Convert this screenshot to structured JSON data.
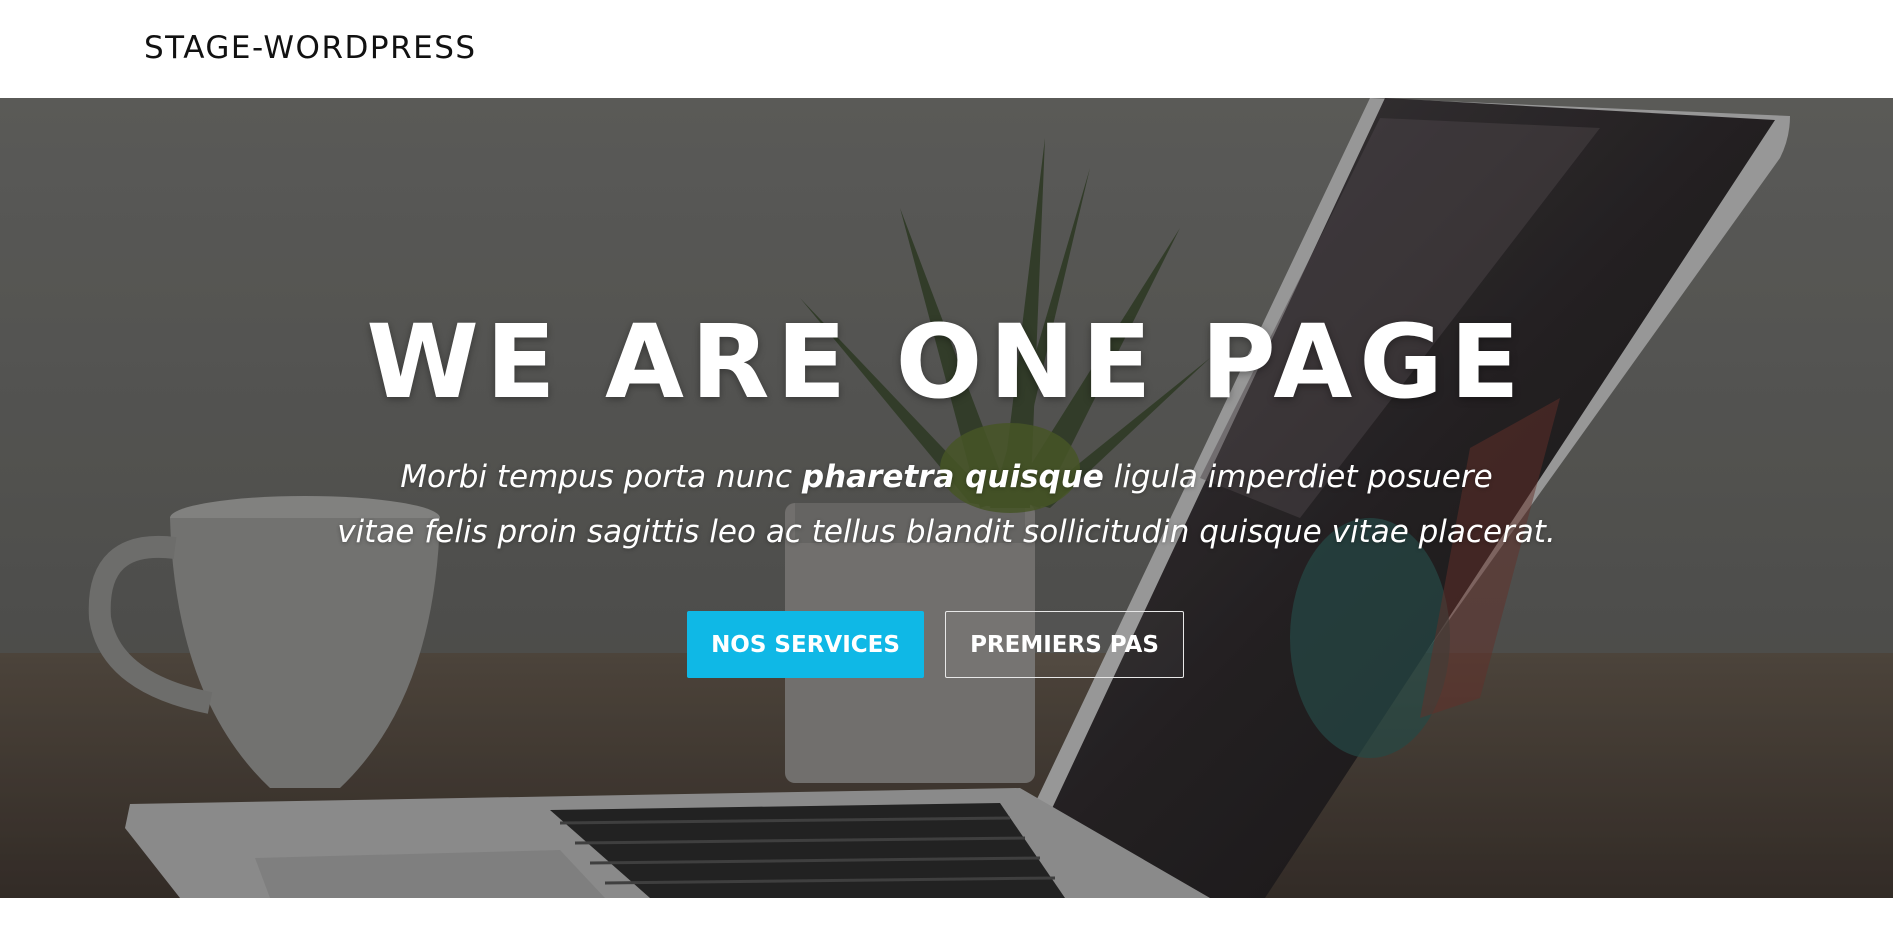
{
  "header": {
    "site_title": "STAGE-WORDPRESS"
  },
  "hero": {
    "headline": "WE ARE ONE PAGE",
    "subtext_line1_pre": "Morbi tempus porta nunc ",
    "subtext_line1_bold": "pharetra quisque",
    "subtext_line1_post": " ligula imperdiet posuere",
    "subtext_line2": "vitae felis proin sagittis leo ac tellus blandit sollicitudin quisque vitae placerat.",
    "primary_button": "NOS SERVICES",
    "secondary_button": "PREMIERS PAS",
    "background_image": "desk-with-laptop-plant-and-coffee-cup"
  },
  "colors": {
    "accent": "#0fb8e6",
    "header_bg": "#ffffff",
    "text": "#ffffff"
  }
}
